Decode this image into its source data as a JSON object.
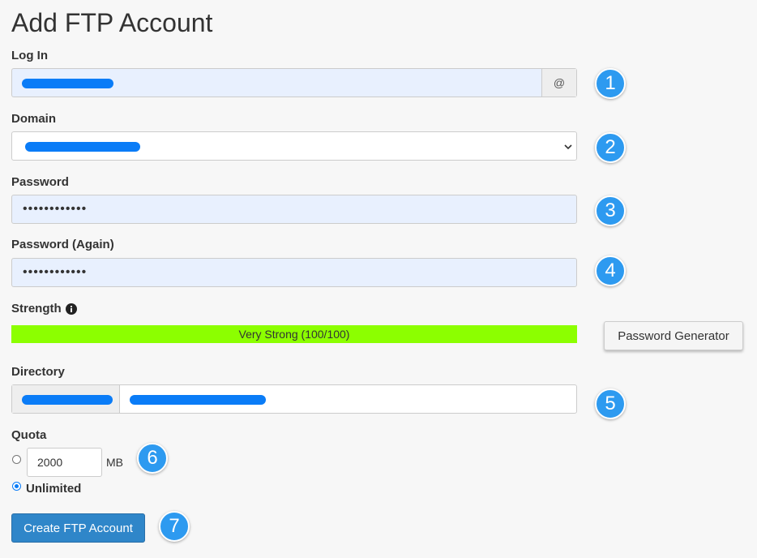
{
  "page": {
    "title": "Add FTP Account"
  },
  "login": {
    "label": "Log In",
    "addon": "@",
    "badge": "1"
  },
  "domain": {
    "label": "Domain",
    "badge": "2"
  },
  "password": {
    "label": "Password",
    "value": "••••••••••••",
    "badge": "3"
  },
  "password_again": {
    "label": "Password (Again)",
    "value": "••••••••••••",
    "badge": "4"
  },
  "strength": {
    "label": "Strength",
    "info_icon": "info-icon",
    "text": "Very Strong (100/100)",
    "level": 100,
    "color": "#8cff00"
  },
  "password_generator": {
    "label": "Password Generator"
  },
  "directory": {
    "label": "Directory",
    "badge": "5"
  },
  "quota": {
    "label": "Quota",
    "value": "2000",
    "unit": "MB",
    "unlimited_label": "Unlimited",
    "selected": "Unlimited",
    "badge": "6"
  },
  "submit": {
    "label": "Create FTP Account",
    "badge": "7"
  },
  "colors": {
    "accent": "#2d9af0",
    "button": "#2f86c9",
    "redaction": "#0a7cf7",
    "autofill": "#e8f0fe"
  }
}
